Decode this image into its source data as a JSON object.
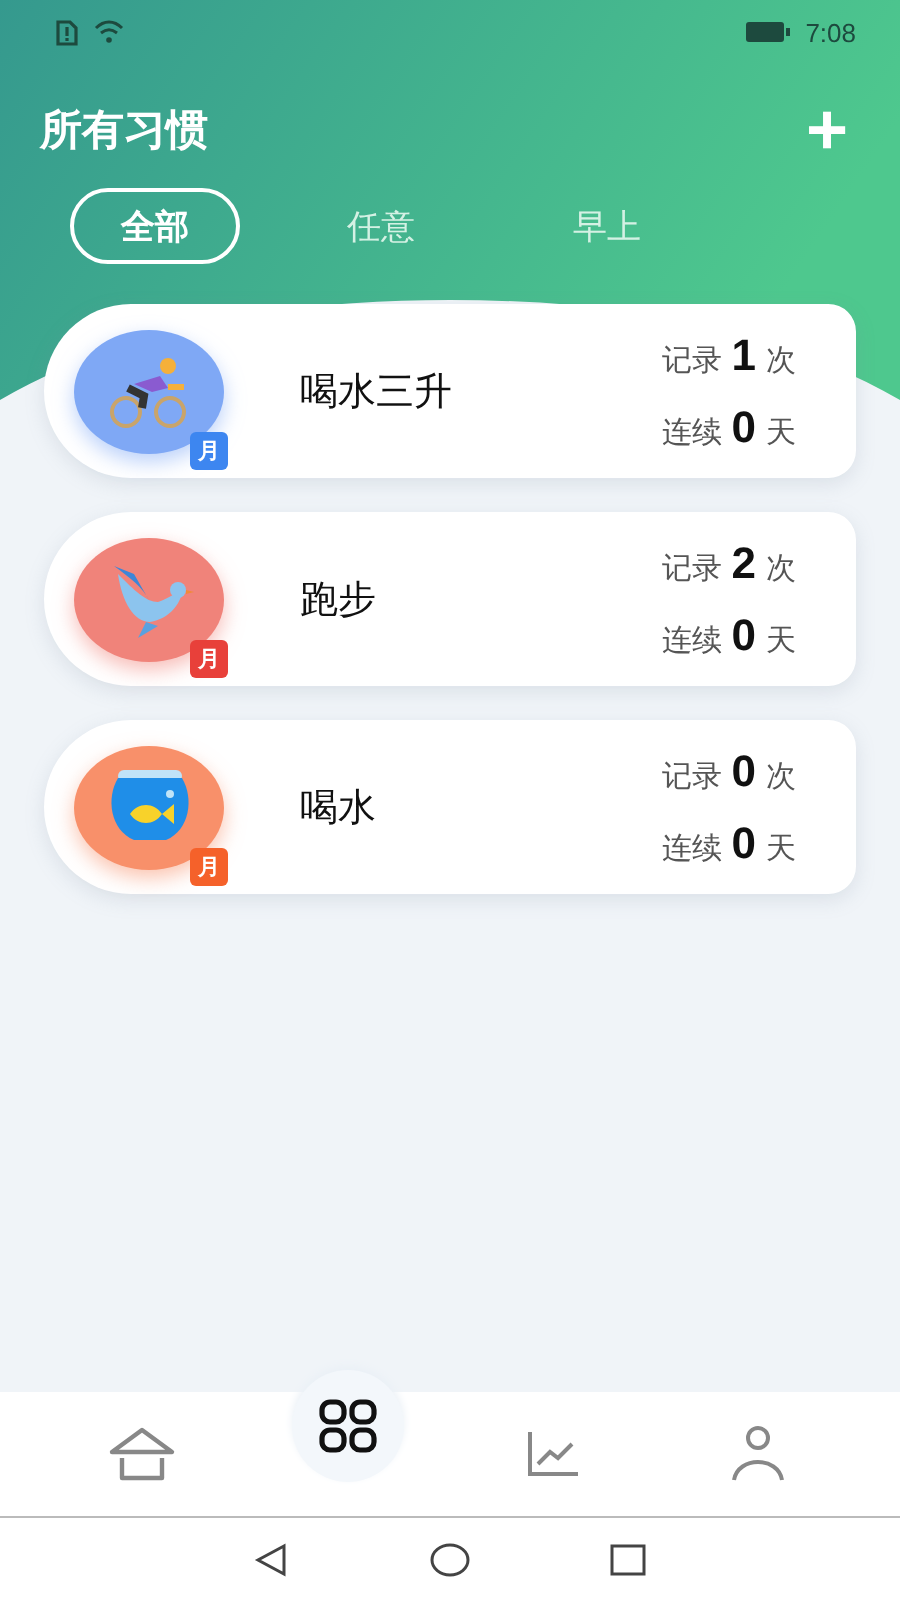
{
  "status_bar": {
    "time": "7:08"
  },
  "header": {
    "title": "所有习惯",
    "add_button": "+"
  },
  "tabs": [
    {
      "label": "全部",
      "selected": true
    },
    {
      "label": "任意",
      "selected": false
    },
    {
      "label": "早上",
      "selected": false
    }
  ],
  "habits": [
    {
      "name": "喝水三升",
      "kind": "bike",
      "color": "#7fa8f5",
      "badge": {
        "label": "月",
        "color": "#3d86f0"
      },
      "record_label": "记录",
      "record": "1",
      "record_unit": "次",
      "streak_label": "连续",
      "streak": "0",
      "streak_unit": "天"
    },
    {
      "name": "跑步",
      "kind": "bird",
      "color": "#f0837a",
      "badge": {
        "label": "月",
        "color": "#e8403a"
      },
      "record_label": "记录",
      "record": "2",
      "record_unit": "次",
      "streak_label": "连续",
      "streak": "0",
      "streak_unit": "天"
    },
    {
      "name": "喝水",
      "kind": "fishbowl",
      "color": "#f8906a",
      "badge": {
        "label": "月",
        "color": "#f5612a"
      },
      "record_label": "记录",
      "record": "0",
      "record_unit": "次",
      "streak_label": "连续",
      "streak": "0",
      "streak_unit": "天"
    }
  ],
  "bottom_nav": [
    {
      "kind": "home",
      "selected": false
    },
    {
      "kind": "grid",
      "selected": true
    },
    {
      "kind": "chart",
      "selected": false
    },
    {
      "kind": "person",
      "selected": false
    }
  ]
}
